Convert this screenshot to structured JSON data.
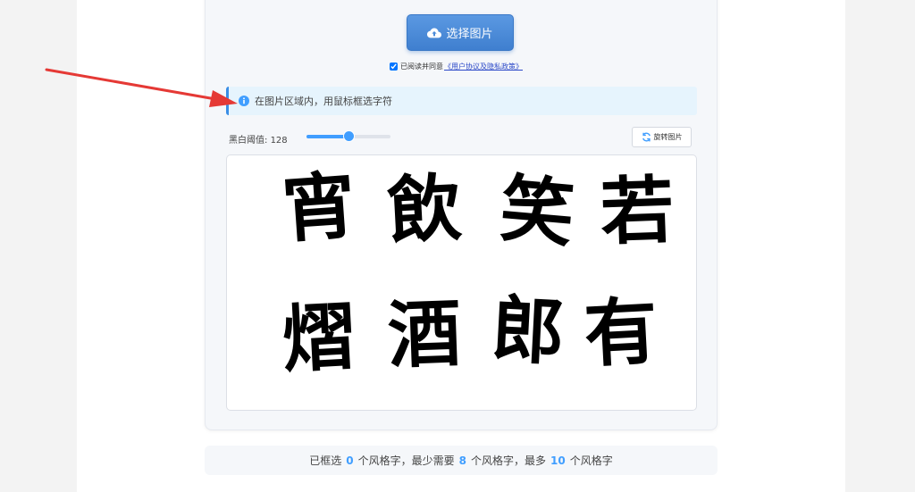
{
  "upload": {
    "label": "选择图片",
    "icon": "cloud-upload-icon"
  },
  "agreement": {
    "checked": true,
    "text": "已阅读并同意",
    "link": "《用户协议及隐私政策》"
  },
  "tip": {
    "icon": "info-icon",
    "text": "在图片区域内，用鼠标框选字符"
  },
  "threshold": {
    "label": "黑白阈值:",
    "value": "128",
    "min": 0,
    "max": 255
  },
  "rotate": {
    "label": "旋转图片",
    "icon": "rotate-icon"
  },
  "image": {
    "characters": [
      "宵",
      "飲",
      "笑",
      "若",
      "熠",
      "酒",
      "郎",
      "有"
    ]
  },
  "count": {
    "part1": "已框选",
    "selected": "0",
    "part2": "个风格字，最少需要",
    "min": "8",
    "part3": "个风格字，最多",
    "max": "10",
    "part4": "个风格字"
  },
  "colors": {
    "accent": "#409eff",
    "annotation_arrow": "#e53935"
  }
}
